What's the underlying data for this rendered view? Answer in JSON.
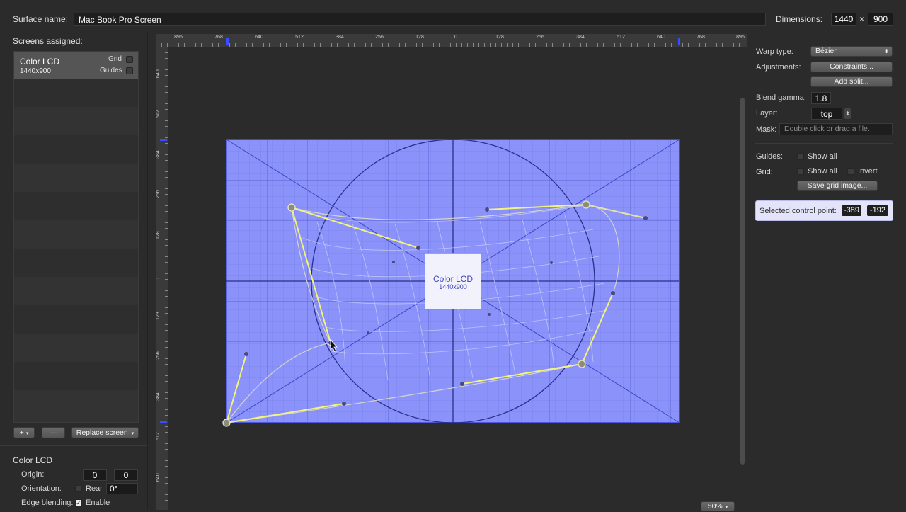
{
  "top": {
    "surface_label": "Surface name:",
    "surface_value": "Mac Book Pro Screen",
    "dimensions_label": "Dimensions:",
    "width": "1440",
    "times": "×",
    "height": "900"
  },
  "left": {
    "screens_label": "Screens assigned:",
    "screen_item": {
      "name": "Color LCD",
      "size": "1440x900",
      "grid": "Grid",
      "guides": "Guides"
    },
    "add": "+",
    "add_arrow": "▾",
    "remove": "—",
    "replace": "Replace screen",
    "replace_arrow": "▾",
    "details": {
      "title": "Color LCD",
      "origin_label": "Origin:",
      "origin_x": "0",
      "origin_y": "0",
      "orientation_label": "Orientation:",
      "rear": "Rear",
      "degree": "0°",
      "edge_label": "Edge blending:",
      "enable": "Enable",
      "enable_check": "✓"
    }
  },
  "ruler": {
    "top": [
      "896",
      "768",
      "640",
      "512",
      "384",
      "256",
      "128",
      "0",
      "128",
      "256",
      "384",
      "512",
      "640",
      "768",
      "896"
    ],
    "left": [
      "640",
      "512",
      "384",
      "256",
      "128",
      "0",
      "128",
      "256",
      "384",
      "512",
      "640"
    ]
  },
  "canvas": {
    "screen_name": "Color LCD",
    "screen_size": "1440x900",
    "zoom": "50%",
    "zoom_arrow": "▾"
  },
  "right": {
    "warp_label": "Warp type:",
    "warp_value": "Bézier",
    "warp_arrow": "⬍",
    "adjust_label": "Adjustments:",
    "constraints": "Constraints...",
    "add_split": "Add split...",
    "gamma_label": "Blend gamma:",
    "gamma_value": "1.8",
    "layer_label": "Layer:",
    "layer_value": "top",
    "layer_arrow": "⬍",
    "mask_label": "Mask:",
    "mask_placeholder": "Double click or drag a file.",
    "guides_label": "Guides:",
    "show_all_guides": "Show all",
    "grid_label": "Grid:",
    "show_all_grid": "Show all",
    "invert": "Invert",
    "save_grid": "Save grid image...",
    "selected_label": "Selected control point:",
    "sel_x": "-389",
    "sel_y": "-192"
  },
  "colors": {
    "screen_fill": "#8b93fb",
    "curve": "#f4f47a",
    "background": "#2b2b2b"
  }
}
